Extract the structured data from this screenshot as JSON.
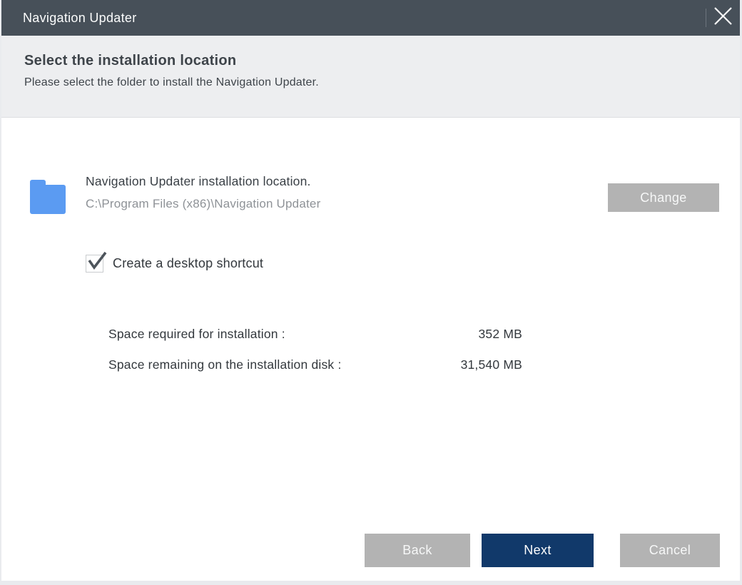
{
  "window": {
    "title": "Navigation Updater",
    "close_icon": "close-x"
  },
  "header": {
    "title": "Select the installation location",
    "subtitle": "Please select the folder to install the Navigation Updater."
  },
  "install_location": {
    "folder_icon": "blue-folder",
    "label": "Navigation Updater installation location.",
    "path": "C:\\Program Files (x86)\\Navigation Updater",
    "change_label": "Change"
  },
  "shortcut": {
    "label": "Create a desktop shortcut",
    "checked": true
  },
  "space": {
    "required_label": "Space required for installation :",
    "required_value": "352 MB",
    "remaining_label": "Space remaining on the installation disk :",
    "remaining_value": "31,540 MB"
  },
  "footer": {
    "back_label": "Back",
    "next_label": "Next",
    "cancel_label": "Cancel"
  },
  "colors": {
    "titlebar": "#475059",
    "header_bg": "#edeef0",
    "accent_navy": "#11396a",
    "button_gray": "#b3b3b3",
    "folder_blue": "#5b9bf2"
  }
}
